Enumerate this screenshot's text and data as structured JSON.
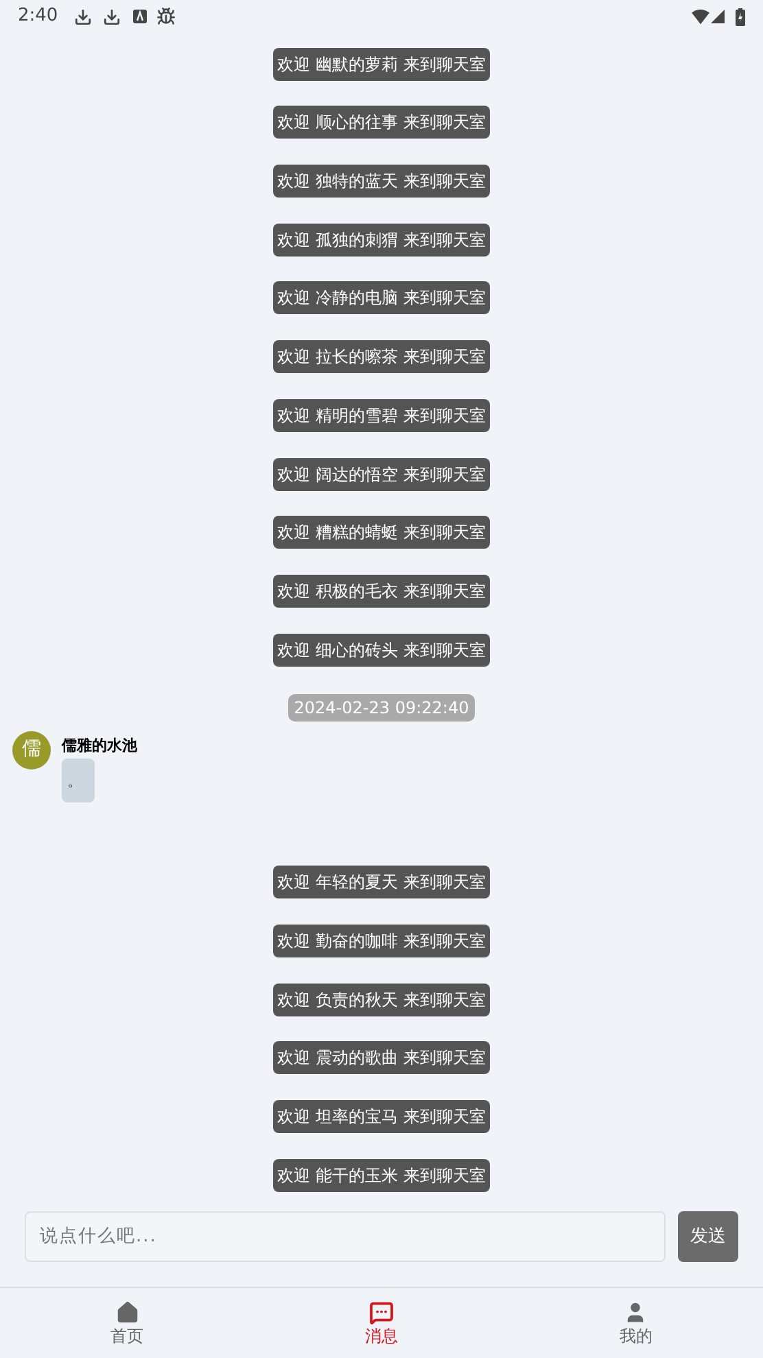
{
  "status_bar": {
    "time": "2:40"
  },
  "chat": [
    {
      "kind": "notice",
      "text": "欢迎 幽默的萝莉 来到聊天室"
    },
    {
      "kind": "notice",
      "text": "欢迎 顺心的往事 来到聊天室"
    },
    {
      "kind": "notice",
      "text": "欢迎 独特的蓝天 来到聊天室"
    },
    {
      "kind": "notice",
      "text": "欢迎 孤独的刺猬 来到聊天室"
    },
    {
      "kind": "notice",
      "text": "欢迎 冷静的电脑 来到聊天室"
    },
    {
      "kind": "notice",
      "text": "欢迎 拉长的嚓茶 来到聊天室"
    },
    {
      "kind": "notice",
      "text": "欢迎 精明的雪碧 来到聊天室"
    },
    {
      "kind": "notice",
      "text": "欢迎 阔达的悟空 来到聊天室"
    },
    {
      "kind": "notice",
      "text": "欢迎 糟糕的蜻蜓 来到聊天室"
    },
    {
      "kind": "notice",
      "text": "欢迎 积极的毛衣 来到聊天室"
    },
    {
      "kind": "notice",
      "text": "欢迎 细心的砖头 来到聊天室"
    },
    {
      "kind": "time",
      "text": "2024-02-23 09:22:40"
    },
    {
      "kind": "message",
      "avatar": "儒",
      "color": "#9a9a2a",
      "sender": "儒雅的水池",
      "text": "。"
    },
    {
      "kind": "notice",
      "text": "欢迎 年轻的夏天 来到聊天室"
    },
    {
      "kind": "notice",
      "text": "欢迎 勤奋的咖啡 来到聊天室"
    },
    {
      "kind": "notice",
      "text": "欢迎 负责的秋天 来到聊天室"
    },
    {
      "kind": "notice",
      "text": "欢迎 震动的歌曲 来到聊天室"
    },
    {
      "kind": "notice",
      "text": "欢迎 坦率的宝马 来到聊天室"
    },
    {
      "kind": "notice",
      "text": "欢迎 能干的玉米 来到聊天室"
    }
  ],
  "composer": {
    "placeholder": "说点什么吧...",
    "send": "发送"
  },
  "nav": [
    {
      "label": "首页",
      "selected": false
    },
    {
      "label": "消息",
      "selected": true
    },
    {
      "label": "我的",
      "selected": false
    }
  ]
}
